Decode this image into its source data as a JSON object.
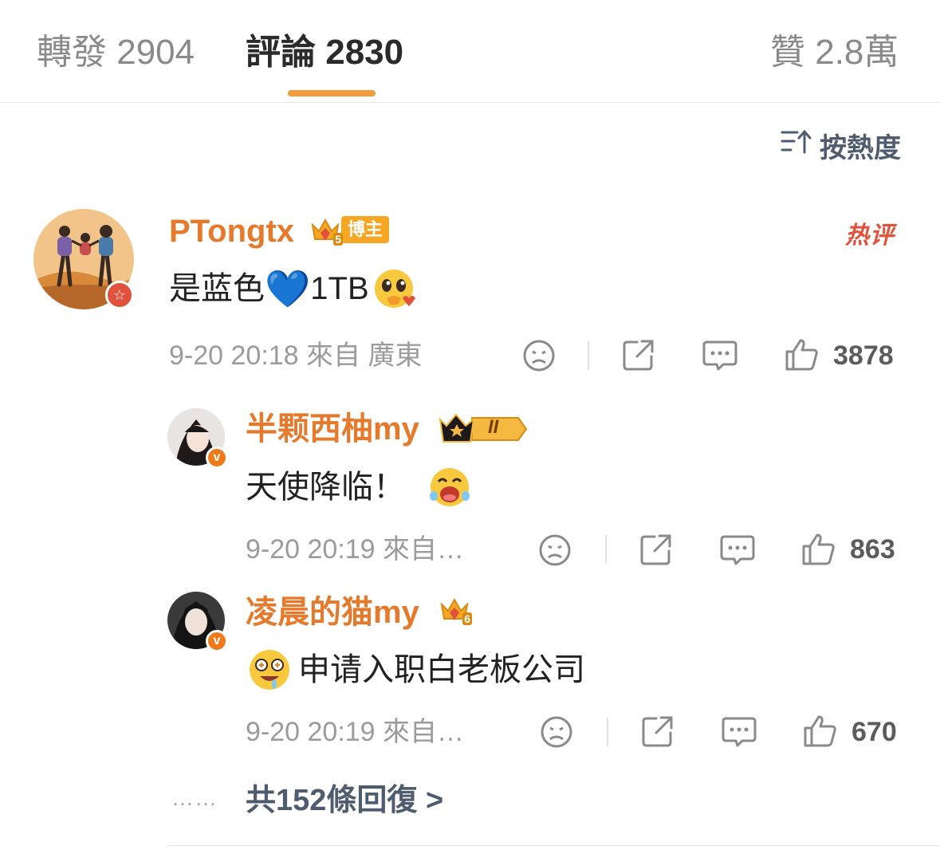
{
  "tabs": [
    {
      "label": "轉發",
      "count": "2904"
    },
    {
      "label": "評論",
      "count": "2830"
    },
    {
      "label": "贊",
      "count": "2.8萬"
    }
  ],
  "sort": {
    "label": "按熱度"
  },
  "hot_tag": "热评",
  "main_comment": {
    "username": "PTongtx",
    "badge": "博主",
    "badge_level": "5",
    "text": "是蓝色",
    "heart_emoji": "💙",
    "text2": "1TB",
    "meta": "9-20 20:18  來自 廣東",
    "likes": "3878"
  },
  "replies": [
    {
      "username": "半颗西柚my",
      "badge_level": "II",
      "text": "天使降临！",
      "meta": "9-20 20:19  來自…",
      "likes": "863"
    },
    {
      "username": "凌晨的猫my",
      "badge_level": "6",
      "text": "申请入职白老板公司",
      "meta": "9-20 20:19  來自…",
      "likes": "670"
    }
  ],
  "more_dots": "……",
  "more_replies": "共152條回復 >",
  "colors": {
    "accent": "#f59a3b",
    "username": "#e57a2c",
    "hot": "#e0523b",
    "link": "#4f5b6e"
  }
}
